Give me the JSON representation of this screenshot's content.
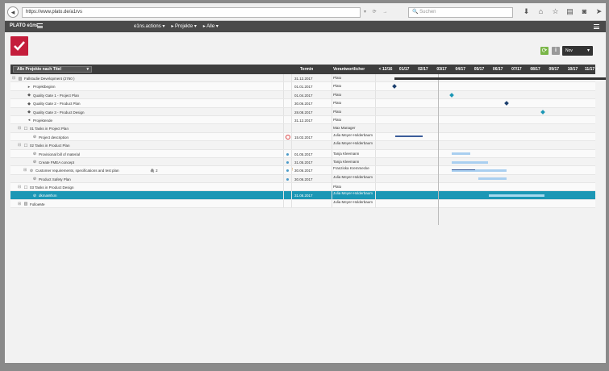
{
  "browser": {
    "back_glyph": "◂",
    "url": "https://www.plato.de/a1rvs",
    "search_placeholder": "Suchen",
    "icons": [
      "download-icon",
      "home-icon",
      "star-icon",
      "clipboard-icon",
      "pocket-icon",
      "send-icon",
      "hamburger-icon"
    ]
  },
  "app": {
    "brand": "PLATO e1ns",
    "menus": [
      "e1ns.actions ▾",
      "▸ Projekte ▾",
      "▸ Alle ▾"
    ]
  },
  "toolbar": {
    "refresh_glyph": "⟳",
    "info_glyph": "i",
    "zoom_label": "Nov"
  },
  "table": {
    "filter_label": "Alle Projekte nach Titel",
    "col_date": "Termin",
    "col_responsible": "Verantwortlicher",
    "months": [
      "< 12/16",
      "01/17",
      "02/17",
      "03/17",
      "04/17",
      "05/17",
      "06/17",
      "07/17",
      "08/17",
      "09/17",
      "10/17",
      "11/17 >"
    ],
    "rows": [
      {
        "name": "Fallstudie Development (2760 )",
        "date": "31.12.2017",
        "resp": "Plato",
        "indent": 0,
        "toggle": "⊟",
        "icon": "▥"
      },
      {
        "name": "Projektbeginn",
        "date": "01.01.2017",
        "resp": "Plato",
        "indent": 2,
        "icon": "▸"
      },
      {
        "name": "Quality Gate 1 - Project Plan",
        "date": "01.04.2017",
        "resp": "Plato",
        "indent": 2,
        "icon": "◆"
      },
      {
        "name": "Quality Gate 2 - Product Plan",
        "date": "30.06.2017",
        "resp": "Plato",
        "indent": 2,
        "icon": "◆"
      },
      {
        "name": "Quality Gate 3 - Product Design",
        "date": "28.08.2017",
        "resp": "Plato",
        "indent": 2,
        "icon": "◆"
      },
      {
        "name": "Projektende",
        "date": "31.12.2017",
        "resp": "Plato",
        "indent": 2,
        "icon": "◂"
      },
      {
        "name": "01 Tasks in Project Plan",
        "date": "",
        "resp": "Max Manager",
        "indent": 1,
        "toggle": "⊟",
        "icon": "☐"
      },
      {
        "name": "Project description",
        "date": "15.02.2017",
        "resp": "Julia Meyer-Holderbaum",
        "indent": 3,
        "icon": "⊘",
        "pulse": true
      },
      {
        "name": "02 Tasks in Product Plan",
        "date": "",
        "resp": "Julia Meyer-Holderbaum",
        "indent": 1,
        "toggle": "⊟",
        "icon": "☐"
      },
      {
        "name": "Provisional bill of material",
        "date": "01.05.2017",
        "resp": "Tanja Kleemann",
        "indent": 3,
        "icon": "⊘",
        "dot": true
      },
      {
        "name": "Create FMEA concept",
        "date": "31.05.2017",
        "resp": "Tanja Kleemann",
        "indent": 3,
        "icon": "⊘",
        "dot": true
      },
      {
        "name": "Customer requirements, specifications and test plan",
        "date": "30.06.2017",
        "resp": "Franziska Kremmecke",
        "indent": 2,
        "icon": "⊘",
        "toggle": "⊞",
        "dot": true,
        "flag": true,
        "clip": "🖇 2"
      },
      {
        "name": "Product Safety Plan",
        "date": "30.06.2017",
        "resp": "Julia Meyer-Holderbaum",
        "indent": 3,
        "icon": "⊘",
        "dot": true
      },
      {
        "name": "03 Tasks in Product Design",
        "date": "",
        "resp": "Plato",
        "indent": 1,
        "toggle": "⊟",
        "icon": "☐"
      },
      {
        "name": "dkmaWfxm",
        "date": "31.08.2017",
        "resp": "Julia Meyer-Holderbaum",
        "indent": 3,
        "icon": "⊘",
        "selected": true
      },
      {
        "name": "FolloeMe",
        "date": "",
        "resp": "Julia Meyer-Holderbaum",
        "indent": 1,
        "toggle": "⊞",
        "icon": "▥"
      }
    ]
  }
}
